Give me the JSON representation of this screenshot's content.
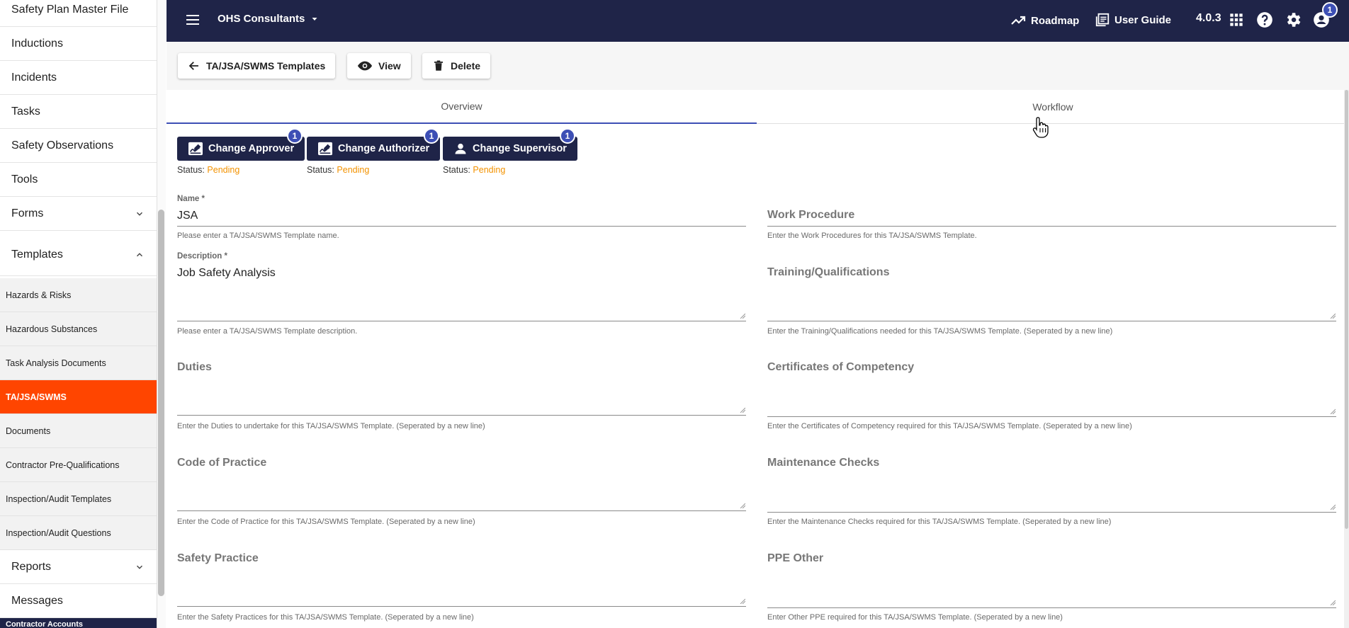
{
  "sidebar": {
    "items": [
      {
        "label": "Safety Plan Master File"
      },
      {
        "label": "Inductions"
      },
      {
        "label": "Incidents"
      },
      {
        "label": "Tasks"
      },
      {
        "label": "Safety Observations"
      },
      {
        "label": "Tools"
      },
      {
        "label": "Forms",
        "expandable": true,
        "expanded": false
      },
      {
        "label": "Templates",
        "expandable": true,
        "expanded": true
      }
    ],
    "template_items": [
      {
        "label": "Hazards & Risks"
      },
      {
        "label": "Hazardous Substances"
      },
      {
        "label": "Task Analysis Documents"
      },
      {
        "label": "TA/JSA/SWMS",
        "active": true
      },
      {
        "label": "Documents"
      },
      {
        "label": "Contractor Pre-Qualifications"
      },
      {
        "label": "Inspection/Audit Templates"
      },
      {
        "label": "Inspection/Audit Questions"
      }
    ],
    "bottom_items": [
      {
        "label": "Reports",
        "expandable": true
      },
      {
        "label": "Messages"
      }
    ],
    "cut_off_label": "Contractor Accounts",
    "active_color": "#ff4500"
  },
  "topbar": {
    "company": "OHS Consultants",
    "roadmap_label": "Roadmap",
    "user_guide_label": "User Guide",
    "version": "4.0.3",
    "notification_count": "1",
    "bg_color": "#1f2448"
  },
  "toolbar": {
    "back_label": "TA/JSA/SWMS Templates",
    "view_label": "View",
    "delete_label": "Delete"
  },
  "tabs": [
    {
      "label": "Overview",
      "active": true
    },
    {
      "label": "Workflow",
      "active": false
    }
  ],
  "approvals": [
    {
      "label": "Change Approver",
      "badge": "1",
      "status_label": "Status:",
      "status": "Pending",
      "icon": "signature-icon"
    },
    {
      "label": "Change Authorizer",
      "badge": "1",
      "status_label": "Status:",
      "status": "Pending",
      "icon": "signature-icon"
    },
    {
      "label": "Change Supervisor",
      "badge": "1",
      "status_label": "Status:",
      "status": "Pending",
      "icon": "person-icon"
    }
  ],
  "form": {
    "name": {
      "label": "Name *",
      "value": "JSA",
      "help": "Please enter a TA/JSA/SWMS Template name."
    },
    "description": {
      "label": "Description *",
      "value": "Job Safety Analysis",
      "help": "Please enter a TA/JSA/SWMS Template description."
    },
    "work_procedure": {
      "label": "Work Procedure",
      "help": "Enter the Work Procedures for this TA/JSA/SWMS Template."
    },
    "training": {
      "label": "Training/Qualifications",
      "help": "Enter the Training/Qualifications needed for this TA/JSA/SWMS Template. (Seperated by a new line)"
    },
    "duties": {
      "label": "Duties",
      "help": "Enter the Duties to undertake for this TA/JSA/SWMS Template. (Seperated by a new line)"
    },
    "certificates": {
      "label": "Certificates of Competency",
      "help": "Enter the Certificates of Competency required for this TA/JSA/SWMS Template. (Seperated by a new line)"
    },
    "code_of_practice": {
      "label": "Code of Practice",
      "help": "Enter the Code of Practice for this TA/JSA/SWMS Template. (Seperated by a new line)"
    },
    "maintenance": {
      "label": "Maintenance Checks",
      "help": "Enter the Maintenance Checks required for this TA/JSA/SWMS Template. (Seperated by a new line)"
    },
    "safety_practice": {
      "label": "Safety Practice",
      "help": "Enter the Safety Practices for this TA/JSA/SWMS Template. (Seperated by a new line)"
    },
    "ppe_other": {
      "label": "PPE Other",
      "help": "Enter Other PPE required for this TA/JSA/SWMS Template. (Seperated by a new line)"
    }
  },
  "colors": {
    "accent": "#3d4fb5",
    "pending": "#f39200"
  }
}
